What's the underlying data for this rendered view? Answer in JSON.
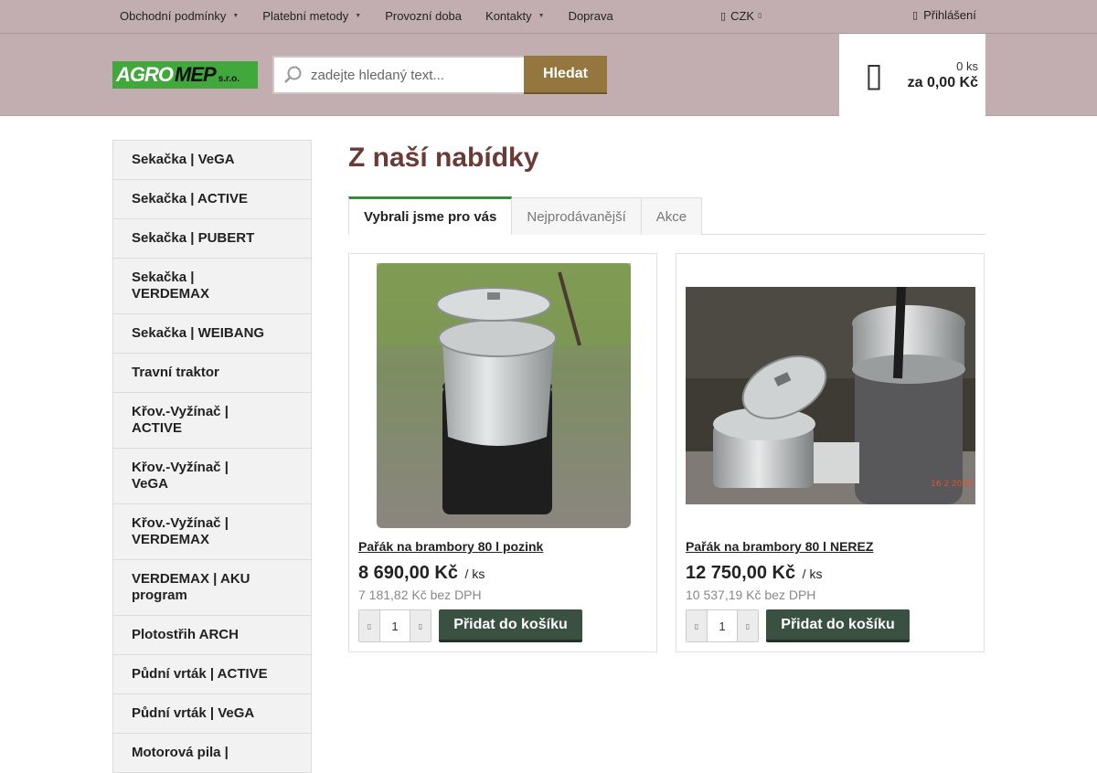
{
  "topnav": {
    "items": [
      {
        "label": "Obchodní podmínky",
        "has_dropdown": true
      },
      {
        "label": "Platební metody",
        "has_dropdown": true
      },
      {
        "label": "Provozní doba",
        "has_dropdown": false
      },
      {
        "label": "Kontakty",
        "has_dropdown": true
      },
      {
        "label": "Doprava",
        "has_dropdown": false
      }
    ],
    "currency": "CZK",
    "login": "Přihlášení"
  },
  "header": {
    "logo": {
      "part1": "AGRO",
      "part2": "MEP",
      "suffix": "s.r.o."
    },
    "search": {
      "placeholder": "zadejte hledaný text...",
      "button": "Hledat"
    },
    "cart": {
      "count": "0 ks",
      "total": "za 0,00 Kč"
    }
  },
  "sidebar": {
    "categories": [
      "Sekačka | VeGA",
      "Sekačka | ACTIVE",
      "Sekačka | PUBERT",
      "Sekačka | VERDEMAX",
      "Sekačka | WEIBANG",
      "Travní traktor",
      "Křov.-Vyžínač | ACTIVE",
      "Křov.-Vyžínač | VeGA",
      "Křov.-Vyžínač | VERDEMAX",
      "VERDEMAX | AKU program",
      "Plotostřih ARCH",
      "Půdní vrták | ACTIVE",
      "Půdní vrták | VeGA",
      "Motorová pila |"
    ]
  },
  "main": {
    "title": "Z naší nabídky",
    "tabs": [
      {
        "label": "Vybrali jsme pro vás",
        "active": true
      },
      {
        "label": "Nejprodávanější",
        "active": false
      },
      {
        "label": "Akce",
        "active": false
      }
    ],
    "products": [
      {
        "name": "Pařák na brambory 80 l pozink",
        "price": "8 690,00 Kč",
        "unit": "/ ks",
        "price_net": "7 181,82 Kč bez DPH",
        "qty": "1",
        "add_label": "Přidat do košíku"
      },
      {
        "name": "Pařák na brambory 80 l NEREZ",
        "price": "12 750,00 Kč",
        "unit": "/ ks",
        "price_net": "10 537,19 Kč bez DPH",
        "qty": "1",
        "add_label": "Přidat do košíku"
      }
    ]
  }
}
